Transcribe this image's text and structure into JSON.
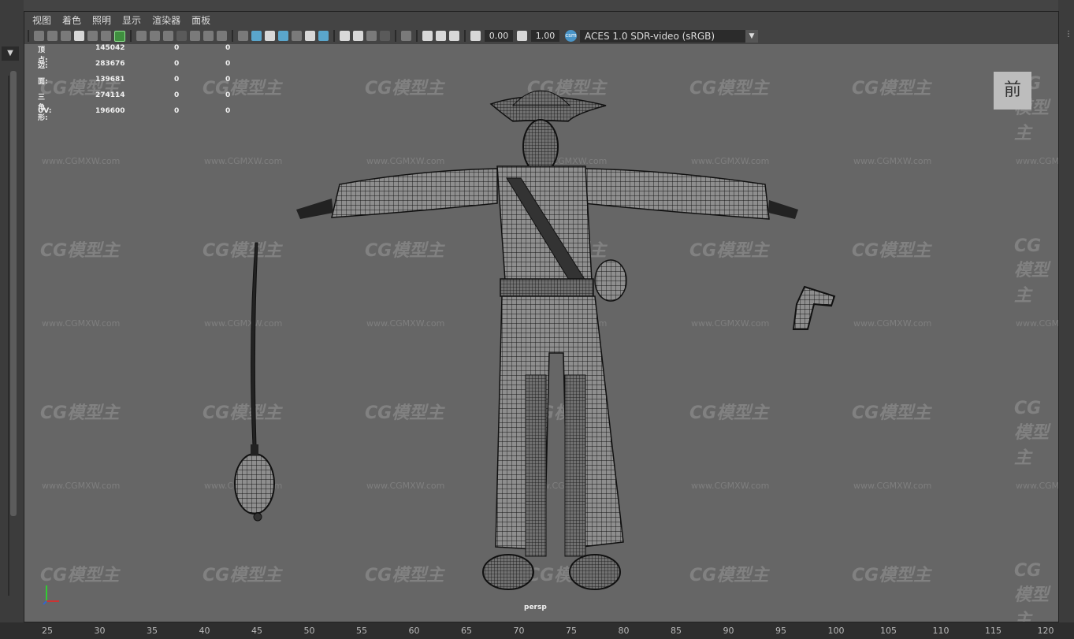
{
  "menu": [
    "视图",
    "着色",
    "照明",
    "显示",
    "渲染器",
    "面板"
  ],
  "toolbar": {
    "exposure_value": "0.00",
    "gamma_value": "1.00",
    "aces_badge": "csm",
    "color_space": "ACES 1.0 SDR-video (sRGB)"
  },
  "stats": [
    {
      "label": "顶点:",
      "v1": "145042",
      "v2": "0",
      "v3": "0"
    },
    {
      "label": "边:",
      "v1": "283676",
      "v2": "0",
      "v3": "0"
    },
    {
      "label": "面:",
      "v1": "139681",
      "v2": "0",
      "v3": "0"
    },
    {
      "label": "三角形:",
      "v1": "274114",
      "v2": "0",
      "v3": "0"
    },
    {
      "label": "UV:",
      "v1": "196600",
      "v2": "0",
      "v3": "0"
    }
  ],
  "view_cube": "前",
  "camera": "persp",
  "watermark": {
    "logo": "CG模型主",
    "url": "www.CGMXW.com"
  },
  "ruler": [
    "25",
    "30",
    "35",
    "40",
    "45",
    "50",
    "55",
    "60",
    "65",
    "70",
    "75",
    "80",
    "85",
    "90",
    "95",
    "100",
    "105",
    "110",
    "115",
    "120"
  ],
  "colors": {
    "viewport": "#666666",
    "ui": "#444444",
    "wire": "#111111",
    "accent": "#5aa6cc"
  }
}
